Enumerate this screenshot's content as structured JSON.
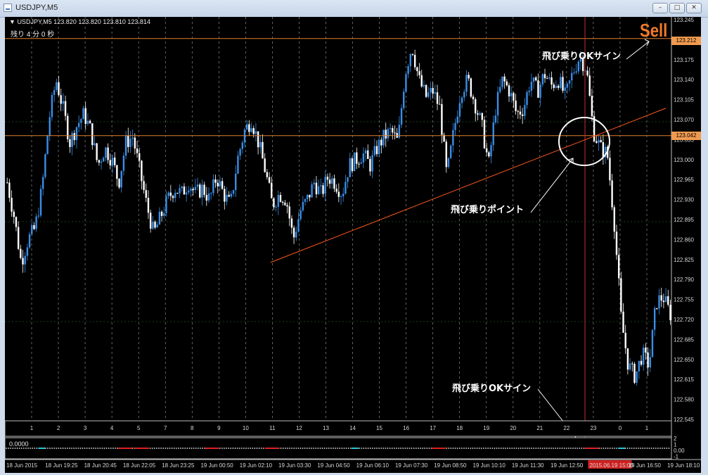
{
  "window": {
    "title": "USDJPY,M5"
  },
  "chart": {
    "header": "USDJPY,M5  123.820 123.820 123.810 123.814",
    "countdown": "残り 4 分 0 秒",
    "sell_label": "Sell",
    "annotations": {
      "ok_sign_top": "飛び乗りOKサイン",
      "jump_point": "飛び乗りポイント",
      "ok_sign_bottom": "飛び乗りOKサイン"
    },
    "price_labels": {
      "top_line": "123.212",
      "mid_line": "123.042"
    },
    "indicator_value": "0.0000",
    "colors": {
      "bull": "#3a8ee6",
      "bear": "#ffffff",
      "trendline": "#ff5a1e",
      "hline": "#e08030",
      "vline": "#c0302a",
      "background": "#000000"
    }
  },
  "chart_data": {
    "type": "candlestick",
    "symbol": "USDJPY",
    "timeframe": "M5",
    "ylim": [
      122.545,
      123.245
    ],
    "y_ticks": [
      "123.245",
      "123.210",
      "123.175",
      "123.140",
      "123.105",
      "123.070",
      "123.035",
      "123.000",
      "122.965",
      "122.930",
      "122.895",
      "122.860",
      "122.825",
      "122.790",
      "122.755",
      "122.720",
      "122.685",
      "122.650",
      "122.615",
      "122.580",
      "122.545"
    ],
    "hlines": [
      123.212,
      123.042
    ],
    "trendline": {
      "from": {
        "x": "19 Jun 03:30",
        "y": 122.82
      },
      "to": {
        "x": "19 Jun 19:20",
        "y": 123.09
      }
    },
    "day_separators": [
      "1",
      "2",
      "3",
      "4",
      "5",
      "7",
      "8",
      "9",
      "10",
      "11",
      "12",
      "13",
      "14",
      "15",
      "16",
      "17",
      "18",
      "19",
      "20",
      "21",
      "22",
      "23",
      "0",
      "1"
    ],
    "x_tick_labels": [
      "18 Jun 2015",
      "18 Jun 19:25",
      "18 Jun 20:45",
      "18 Jun 22:05",
      "18 Jun 23:25",
      "19 Jun 00:50",
      "19 Jun 02:10",
      "19 Jun 03:30",
      "19 Jun 04:50",
      "19 Jun 06:10",
      "19 Jun 07:30",
      "19 Jun 08:50",
      "19 Jun 10:10",
      "19 Jun 11:30",
      "19 Jun 12:50",
      "2015.06.19 15:00",
      "19 Jun 16:50",
      "19 Jun 18:10"
    ],
    "highlighted_time": "2015.06.19 15:00",
    "close_path": [
      122.96,
      122.9,
      122.82,
      122.86,
      122.88,
      122.95,
      123.07,
      123.14,
      123.09,
      123.03,
      123.06,
      123.08,
      123.05,
      122.99,
      123.02,
      123.0,
      122.96,
      123.03,
      123.04,
      122.98,
      122.92,
      122.87,
      122.9,
      122.93,
      122.95,
      122.94,
      122.96,
      122.94,
      122.95,
      122.93,
      122.97,
      122.94,
      122.92,
      123.0,
      123.05,
      123.07,
      123.03,
      122.98,
      122.92,
      122.94,
      122.93,
      122.86,
      122.91,
      122.93,
      122.96,
      122.94,
      122.97,
      122.96,
      122.94,
      122.99,
      123.0,
      123.01,
      122.99,
      123.02,
      123.04,
      123.05,
      123.03,
      123.15,
      123.2,
      123.14,
      123.11,
      123.12,
      123.09,
      122.97,
      123.05,
      123.12,
      123.14,
      123.1,
      123.06,
      122.99,
      123.09,
      123.14,
      123.12,
      123.08,
      123.09,
      123.14,
      123.12,
      123.15,
      123.13,
      123.14,
      123.11,
      123.15,
      123.18,
      123.16,
      123.05,
      123.02,
      123.01,
      122.89,
      122.72,
      122.64,
      122.62,
      122.66,
      122.64,
      122.75,
      122.76,
      122.73,
      122.71
    ]
  },
  "indicator": {
    "ylim": [
      -1,
      2
    ],
    "y_ticks": [
      "2",
      "1",
      "0.00",
      "-1"
    ],
    "signal_dots": [
      {
        "pos": 0.17,
        "color": "red"
      },
      {
        "pos": 0.195,
        "color": "red"
      },
      {
        "pos": 0.3,
        "color": "red"
      },
      {
        "pos": 0.39,
        "color": "red"
      },
      {
        "pos": 0.64,
        "color": "red"
      },
      {
        "pos": 0.87,
        "color": "red"
      }
    ]
  }
}
